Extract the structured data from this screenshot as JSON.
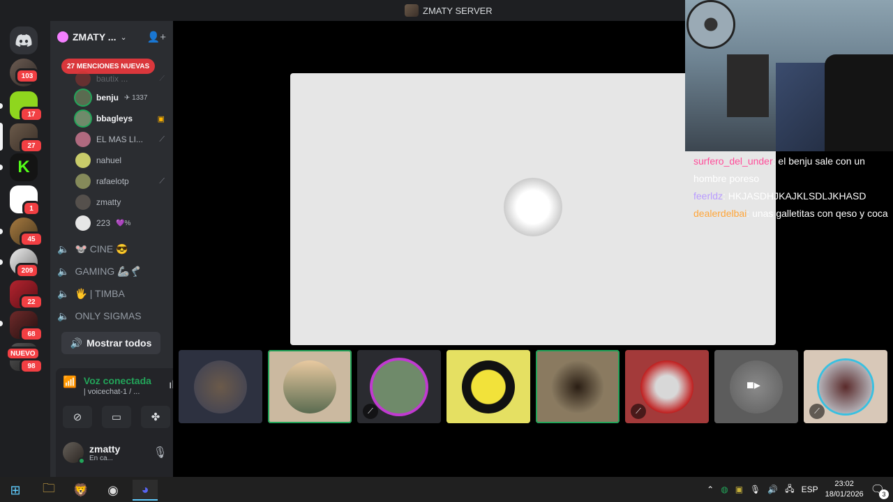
{
  "window": {
    "title": "ZMATY SERVER"
  },
  "rail": {
    "servers": [
      {
        "id": "dm",
        "badge": "103"
      },
      {
        "id": "s1",
        "badge": "17",
        "color": "#8fd61e"
      },
      {
        "id": "s2",
        "badge": "27"
      },
      {
        "id": "s3",
        "badge": "",
        "color": "#53fc18"
      },
      {
        "id": "s4",
        "badge": "1"
      },
      {
        "id": "s5",
        "badge": "45"
      },
      {
        "id": "s6",
        "badge": "209"
      },
      {
        "id": "s7",
        "badge": "22"
      },
      {
        "id": "s8",
        "badge": "68"
      },
      {
        "id": "s9",
        "badge": "98"
      }
    ],
    "new_label": "NUEVO"
  },
  "sidebar": {
    "server_name": "ZMATY ...",
    "mentions_banner": "27 MENCIONES NUEVAS",
    "voice_users": [
      {
        "name": "bautix ...",
        "extra": ""
      },
      {
        "name": "benju",
        "extra": "✈ 1337"
      },
      {
        "name": "bbagleys",
        "extra": ""
      },
      {
        "name": "EL MAS LI...",
        "extra": ""
      },
      {
        "name": "nahuel",
        "extra": ""
      },
      {
        "name": "rafaelotp",
        "extra": ""
      },
      {
        "name": "zmatty",
        "extra": ""
      },
      {
        "name": "223",
        "extra": "💜%"
      }
    ],
    "voice_channels": [
      {
        "label": "🐭 CINE 😎"
      },
      {
        "label": "GAMING 🦾🦿"
      },
      {
        "label": "🖐 | TIMBA"
      },
      {
        "label": "ONLY SIGMAS"
      }
    ],
    "show_all_label": "Mostrar todos"
  },
  "voice_panel": {
    "status": "Voz conectada",
    "channel": "| voicechat-1 / ...",
    "user": {
      "name": "zmatty",
      "status": "En ca..."
    }
  },
  "chat": [
    {
      "user": "surfero_del_under",
      "text": ": el benju sale con un hombre poreso"
    },
    {
      "user": "feerldz",
      "text": ": HKJASDHJKAJKLSDLJKHASD"
    },
    {
      "user": "dealerdelbai",
      "text": ": unas galletitas con qeso y coca"
    }
  ],
  "taskbar": {
    "language": "ESP",
    "time": "23:02",
    "date": "18/01/2026",
    "notifications": "3"
  },
  "colors": {
    "accent_green": "#23a55a",
    "badge_red": "#f23f43",
    "discord_blurple": "#5865f2"
  }
}
